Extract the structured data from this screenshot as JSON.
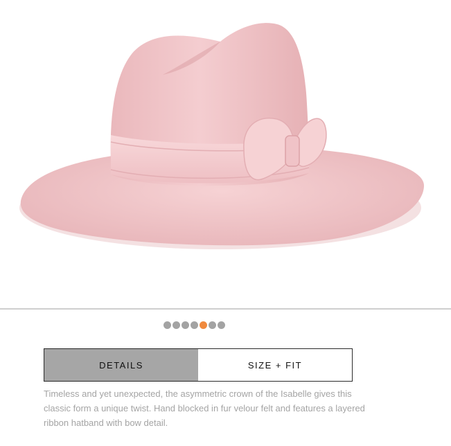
{
  "product": {
    "image_alt": "Pink fur felt wide-brim hat with asymmetric crown and ribbon bow",
    "colors": {
      "felt": "#f1c6c9",
      "felt_shadow": "#e3aeb3",
      "ribbon": "#f5cfd2",
      "accent_dot": "#f08a3e",
      "inactive_dot": "#a3a3a3",
      "tab_active_bg": "#a6a6a6"
    }
  },
  "carousel": {
    "total": 7,
    "active_index": 4
  },
  "tabs": [
    {
      "label": "DETAILS",
      "active": true
    },
    {
      "label": "SIZE + FIT",
      "active": false
    }
  ],
  "description": "Timeless and yet unexpected, the asymmetric crown of the Isabelle gives this classic form a unique twist. Hand blocked in fur velour felt and features a layered ribbon hatband with bow detail."
}
